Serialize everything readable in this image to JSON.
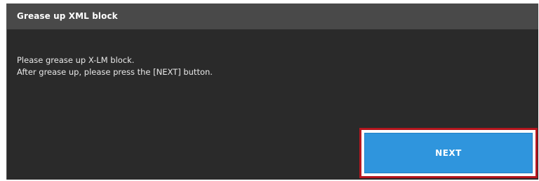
{
  "dialog": {
    "title": "Grease up XML block",
    "message_lines": [
      "Please grease up X-LM block.",
      "After grease up, please press the [NEXT] button."
    ],
    "next_label": "NEXT"
  },
  "colors": {
    "header": "#494949",
    "body": "#2a2a2a",
    "button": "#2f95dd",
    "highlight": "#b5161e"
  }
}
